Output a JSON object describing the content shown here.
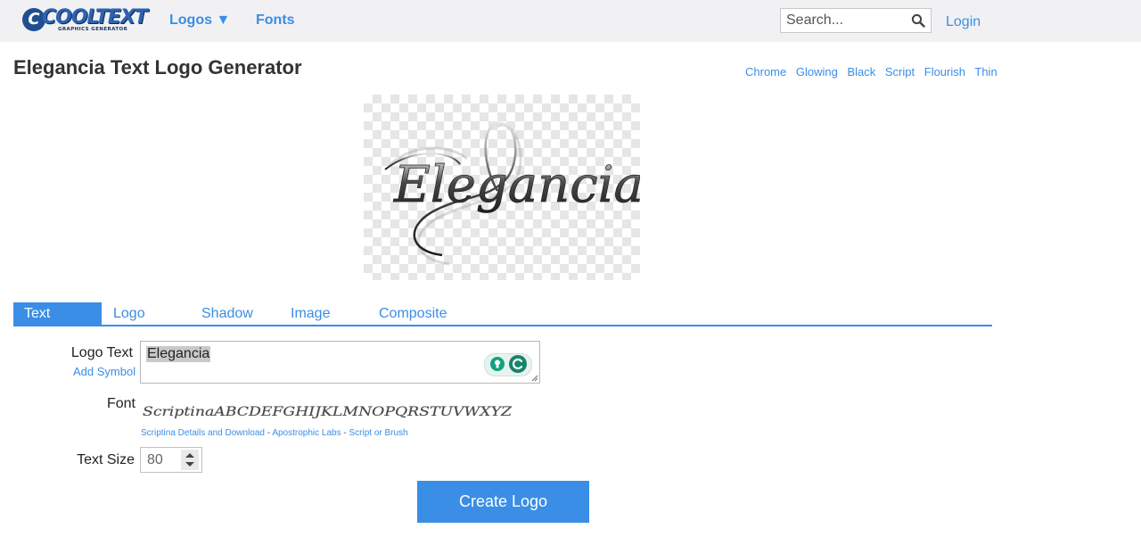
{
  "header": {
    "logo_text": "COOLTEXT",
    "logo_subtitle": "GRAPHICS GENERATOR",
    "nav": [
      {
        "label": "Logos ▼"
      },
      {
        "label": "Fonts"
      }
    ],
    "search_placeholder": "Search...",
    "login_label": "Login"
  },
  "page": {
    "title": "Elegancia Text Logo Generator",
    "style_links": [
      "Chrome",
      "Glowing",
      "Black",
      "Script",
      "Flourish",
      "Thin"
    ]
  },
  "preview": {
    "text": "Elegancia"
  },
  "tabs": [
    {
      "label": "Text",
      "active": true
    },
    {
      "label": "Logo"
    },
    {
      "label": "Shadow"
    },
    {
      "label": "Image"
    },
    {
      "label": "Composite"
    }
  ],
  "form": {
    "logo_text_label": "Logo Text",
    "add_symbol_label": "Add Symbol",
    "logo_text_value": "Elegancia",
    "font_label": "Font",
    "font_sample": "ScriptinaABCDEFGHIJKLMNOPQRSTUVWXYZ",
    "font_details_link": "Scriptina Details and Download",
    "font_author_link": "Apostrophic Labs",
    "font_category_link": "Script or Brush",
    "font_separator": " - ",
    "text_size_label": "Text Size",
    "text_size_value": "80",
    "create_button": "Create Logo"
  },
  "icons": {
    "search": "magnifier-icon",
    "grammarly_hint": "lightbulb-icon",
    "grammarly": "grammarly-icon",
    "resize": "resize-handle-icon",
    "spinner": "spinner-arrows-icon"
  },
  "colors": {
    "accent": "#3a8ee6",
    "topbar": "#f1f1f4",
    "heading": "#333333"
  }
}
